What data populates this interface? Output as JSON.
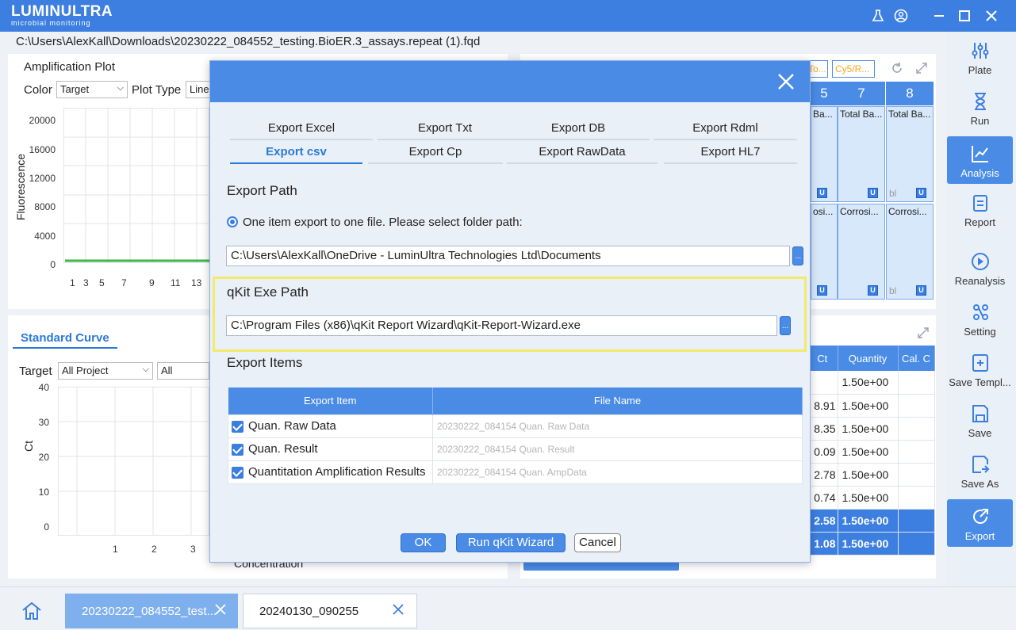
{
  "app": {
    "logo_main": "LUMINULTRA",
    "logo_sub": "microbial monitoring",
    "file_path": "C:\\Users\\AlexKall\\Downloads\\20230222_084552_testing.BioER.3_assays.repeat (1).fqd"
  },
  "nav": [
    {
      "label": "Plate",
      "icon": "sliders-icon"
    },
    {
      "label": "Run",
      "icon": "hourglass-icon"
    },
    {
      "label": "Analysis",
      "icon": "chart-icon",
      "active": true
    },
    {
      "label": "Report",
      "icon": "report-icon"
    },
    {
      "label": "Reanalysis",
      "icon": "play-icon"
    },
    {
      "label": "Setting",
      "icon": "nodes-icon"
    },
    {
      "label": "Save Templ...",
      "icon": "save-template-icon"
    },
    {
      "label": "Save",
      "icon": "save-icon"
    },
    {
      "label": "Save As",
      "icon": "save-as-icon"
    },
    {
      "label": "Export",
      "icon": "export-icon",
      "active": true
    }
  ],
  "amplification": {
    "title": "Amplification Plot",
    "color_label": "Color",
    "color_value": "Target",
    "plot_type_label": "Plot Type",
    "plot_type_value": "Linea",
    "ylabel": "Fluorescence",
    "yticks": [
      "20000",
      "16000",
      "12000",
      "8000",
      "4000",
      "0"
    ],
    "xticks": [
      "1",
      "3",
      "5",
      "7",
      "9",
      "11",
      "13"
    ]
  },
  "standard_curve": {
    "tab": "Standard Curve",
    "target_label": "Target",
    "target_value": "All Project",
    "second_value": "All",
    "ylabel": "Ct",
    "yticks": [
      "40",
      "30",
      "20",
      "10",
      "0"
    ],
    "xticks": [
      "1",
      "2",
      "3"
    ],
    "xlabel": "Concentration"
  },
  "plate": {
    "columns": [
      "5",
      "7",
      "8"
    ],
    "row1": [
      "Ba...",
      "Total Ba...",
      "Total Ba..."
    ],
    "row2": [
      "osi...",
      "Corrosi...",
      "Corrosi..."
    ],
    "bl": "bl",
    "u": "U",
    "toolbar_label_1": "To...",
    "toolbar_label_2": "Cy5/R..."
  },
  "results": {
    "headers": [
      "Ct",
      "Quantity",
      "Cal. C"
    ],
    "rows": [
      {
        "ct": "",
        "qty": "1.50e+00",
        "sel": false
      },
      {
        "ct": "8.91",
        "qty": "1.50e+00",
        "sel": false
      },
      {
        "ct": "8.35",
        "qty": "1.50e+00",
        "sel": false
      },
      {
        "ct": "0.09",
        "qty": "1.50e+00",
        "sel": false
      },
      {
        "ct": "2.78",
        "qty": "1.50e+00",
        "sel": false
      },
      {
        "ct": "0.74",
        "qty": "1.50e+00",
        "sel": false
      },
      {
        "ct": "2.58",
        "qty": "1.50e+00",
        "sel": true
      },
      {
        "ct": "1.08",
        "qty": "1.50e+00",
        "sel": true
      }
    ]
  },
  "modal": {
    "tabs_row1": [
      "Export Excel",
      "Export Txt",
      "Export DB",
      "Export Rdml"
    ],
    "tabs_row2": [
      "Export csv",
      "Export Cp",
      "Export RawData",
      "Export HL7"
    ],
    "export_path_title": "Export Path",
    "radio_label": "One item export to one file. Please select folder path:",
    "export_path_value": "C:\\Users\\AlexKall\\OneDrive - LuminUltra Technologies Ltd\\Documents",
    "qkit_title": "qKit Exe Path",
    "qkit_path_value": "C:\\Program Files (x86)\\qKit Report Wizard\\qKit-Report-Wizard.exe",
    "browse_label": "...",
    "items_title": "Export Items",
    "col_item": "Export Item",
    "col_file": "File Name",
    "items": [
      {
        "item": "Quan. Raw Data",
        "file": "20230222_084154 Quan. Raw Data"
      },
      {
        "item": "Quan. Result",
        "file": "20230222_084154 Quan. Result"
      },
      {
        "item": "Quantitation Amplification Results",
        "file": "20230222_084154 Quan. AmpData"
      }
    ],
    "ok_label": "OK",
    "wizard_label": "Run qKit Wizard",
    "cancel_label": "Cancel"
  },
  "bottom_tabs": [
    {
      "label": "20230222_084552_test...",
      "active": true
    },
    {
      "label": "20240130_090255",
      "active": false
    }
  ],
  "colors": {
    "accent": "#4a8be6",
    "titlebar": "#3d7fe0",
    "highlight": "#f3ea6a",
    "curve": "#3cb84a"
  }
}
